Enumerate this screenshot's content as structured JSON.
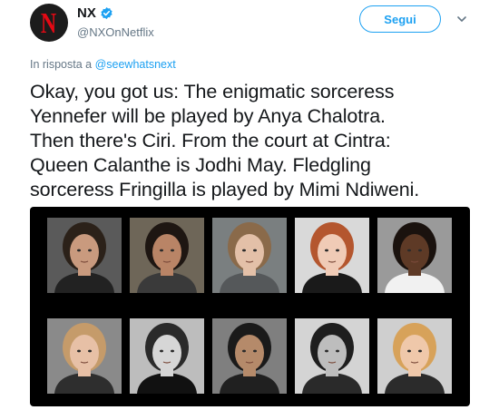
{
  "account": {
    "display_name": "NX",
    "handle": "@NXOnNetflix",
    "avatar_letter": "N",
    "verified_icon": "verified-badge-icon"
  },
  "follow_button_label": "Segui",
  "menu_icon": "chevron-down-icon",
  "reply": {
    "prefix": "In risposta a",
    "mention": "@seewhatsnext"
  },
  "tweet_lines": [
    "Okay, you got us: The enigmatic sorceress",
    "Yennefer will be played by Anya Chalotra.",
    "Then there's Ciri. From the court at Cintra:",
    "Queen Calanthe is Jodhi May. Fledgling",
    "sorceress Fringilla is played by Mimi Ndiweni."
  ],
  "colors": {
    "accent": "#1da1f2",
    "brand_red": "#e50914",
    "muted_text": "#657786",
    "text": "#14171a",
    "media_bg": "#000000"
  },
  "media": {
    "photos": [
      {
        "bg": "#5a5a5a",
        "skin": "#c99a7e",
        "hair": "#2b2119",
        "shirt": "#222222"
      },
      {
        "bg": "#6e6658",
        "skin": "#b98466",
        "hair": "#1e1612",
        "shirt": "#3a3a3a"
      },
      {
        "bg": "#7a7f80",
        "skin": "#e3c0a8",
        "hair": "#8a6a4a",
        "shirt": "#55585a"
      },
      {
        "bg": "#d9d9d9",
        "skin": "#f0cbb6",
        "hair": "#b4562e",
        "shirt": "#1a1a1a"
      },
      {
        "bg": "#9a9a9a",
        "skin": "#5e3a26",
        "hair": "#1a120e",
        "shirt": "#f1f1f1"
      },
      {
        "bg": "#8a8a8a",
        "skin": "#e7c0a6",
        "hair": "#c59b6a",
        "shirt": "#2e2e2e"
      },
      {
        "bg": "#bdbdbd",
        "skin": "#d6d6d6",
        "hair": "#2a2a2a",
        "shirt": "#111111"
      },
      {
        "bg": "#7f7f7f",
        "skin": "#b58a6a",
        "hair": "#1a1a1a",
        "shirt": "#202020"
      },
      {
        "bg": "#d4d4d4",
        "skin": "#bdbdbd",
        "hair": "#1e1e1e",
        "shirt": "#2a2a2a"
      },
      {
        "bg": "#cfcfcf",
        "skin": "#efc8aa",
        "hair": "#d7a25a",
        "shirt": "#2b2b2b"
      }
    ]
  }
}
